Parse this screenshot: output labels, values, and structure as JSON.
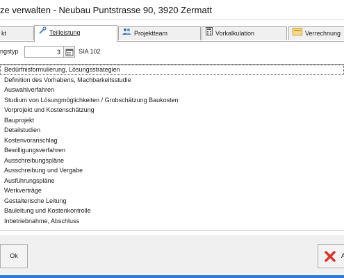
{
  "window": {
    "title": "ze verwalten - Neubau Puntstrasse 90, 3920 Zermatt"
  },
  "tabs": [
    {
      "label": "kt",
      "icon": "document-icon",
      "active": false
    },
    {
      "label": "Teilleistung",
      "icon": "tools-icon",
      "active": true
    },
    {
      "label": "Projektteam",
      "icon": "people-icon",
      "active": false
    },
    {
      "label": "Vorkalkulation",
      "icon": "calculator-icon",
      "active": false
    },
    {
      "label": "Verrechnung",
      "icon": "invoice-icon",
      "active": false
    }
  ],
  "form": {
    "type_label": "ngstyp",
    "type_value": "3",
    "standard": "SIA 102"
  },
  "phases": [
    "Bedürfnisformulierung, Lösungsstrategien",
    "Definition des Vorhabens, Machbarkeitsstudie",
    "Auswahlverfahren",
    "Studium von Lösungmöglichkeiten / Grobschätzung Baukosten",
    "Vorprojekt und Kostenschätzung",
    "Bauprojekt",
    "Detailstudien",
    "Kostenvoranschlag",
    "Bewilligungsverfahren",
    "Ausschreibungspläne",
    "Ausschreibung und Vergabe",
    "Ausführungspläne",
    "Werkverträge",
    "Gestalterische Leitung",
    "Bauleitung und Kostenkontrolle",
    "Inbetriebnahme, Abschluss"
  ],
  "selected_phase": "Bedürfnisformulierung, Lösungsstrategien",
  "buttons": {
    "ok": "Ok",
    "cancel": "A"
  },
  "colors": {
    "accent": "#2b79d6",
    "cancel_x": "#d9352b",
    "tab_border": "#a8a8a8"
  }
}
